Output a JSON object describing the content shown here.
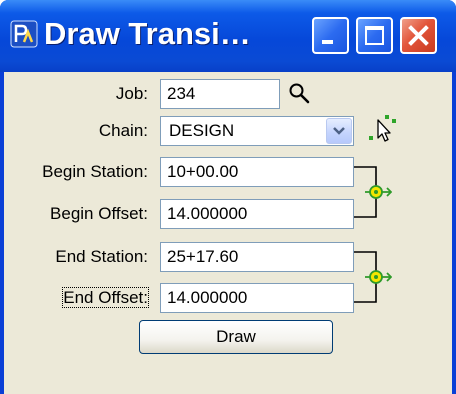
{
  "window": {
    "title": "Draw Transi…"
  },
  "form": {
    "job_label": "Job:",
    "job_value": "234",
    "chain_label": "Chain:",
    "chain_value": "DESIGN",
    "begin_station_label": "Begin Station:",
    "begin_station_value": "10+00.00",
    "begin_offset_label": "Begin Offset:",
    "begin_offset_value": "14.000000",
    "end_station_label": "End Station:",
    "end_station_value": "25+17.60",
    "end_offset_label": "End Offset:",
    "end_offset_value": "14.000000",
    "draw_label": "Draw"
  },
  "icons": {
    "app": "app-icon",
    "job_search": "search-icon",
    "chain_pick": "pick-element-cursor-icon",
    "begin_lock": "link-lock-icon",
    "end_lock": "link-lock-icon"
  },
  "colors": {
    "titlebar": "#0a4ad4",
    "client": "#ece9d8",
    "close_button": "#e2553a",
    "field_border": "#7f9db9"
  }
}
